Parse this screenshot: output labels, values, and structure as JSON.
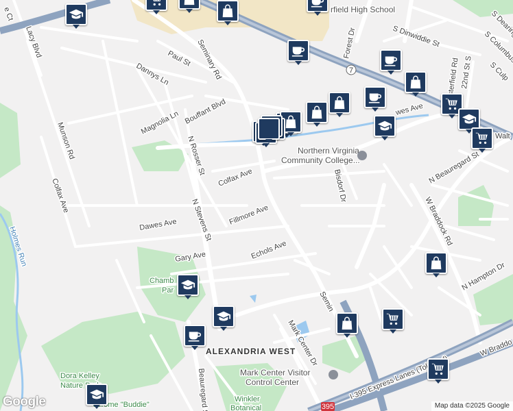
{
  "labels": {
    "lacy": "Lacy Blvd",
    "paul": "Paul St",
    "seminary_rd": "Seminary Rd",
    "dannys": "Dannys Ln",
    "magnolia": "Magnolia Ln",
    "bouffant": "Bouffant Blvd",
    "munson": "Munson Rd",
    "n_rosser": "N Rosser St",
    "colfax_ave_east": "Colfax Ave",
    "colfax_ave_west": "Colfax Ave",
    "holmes_run": "Holmes Run",
    "dawes_west": "Dawes Ave",
    "n_stevens": "N Stevens St",
    "fillmore": "Fillmore Ave",
    "gary": "Gary Ave",
    "echols": "Echols Ave",
    "chamb": "Chamb",
    "park": "Par",
    "alexandria_west": "ALEXANDRIA WEST",
    "dora_kelley_1": "Dora Kelley",
    "dora_kelley_2": "Nature Park",
    "jerome": "Jerome \"Buddie\"",
    "winkler_1": "Winkler",
    "winkler_2": "Botanical",
    "mark_center_dr": "Mark Center Dr",
    "mark_center_vc_1": "Mark Center Visitor",
    "mark_center_vc_2": "Control Center",
    "nvcc_1": "Northern Virginia",
    "nvcc_2": "Community College...",
    "bisdorf": "Bisdorf Dr",
    "forest": "Forest Dr",
    "s_dinwiddie": "S Dinwiddie St",
    "field_high": "rfield High School",
    "dawes_east": "wes Ave",
    "n_beauregard": "N Beauregard St",
    "w_braddock_rd": "W Braddock Rd",
    "n_hampton": "N Hampton Dr",
    "seminary_south": "Semin",
    "i395_express": "I-395 Express Lanes (Toll road)",
    "w_braddo": "W Braddo",
    "beauregard_st": "Beauregard St",
    "s_chesterfield": "sterfield Rd",
    "s_22nd": "22nd St S",
    "s_columbus": "S Columbus St",
    "s_dearing": "S Dearing St",
    "s_culpeper": "S Culp",
    "walt": "Walt",
    "route7": "7",
    "route395": "395",
    "ct": "e Ct"
  },
  "markers": [
    {
      "type": "school",
      "icon": "school-icon"
    },
    {
      "type": "shopping",
      "icon": "cart-icon"
    },
    {
      "type": "store",
      "icon": "bag-icon"
    },
    {
      "type": "store",
      "icon": "bag-icon"
    },
    {
      "type": "cafe",
      "icon": "coffee-icon"
    },
    {
      "type": "cafe",
      "icon": "coffee-icon"
    },
    {
      "type": "cafe",
      "icon": "coffee-icon"
    },
    {
      "type": "store",
      "icon": "bag-icon"
    },
    {
      "type": "cafe",
      "icon": "coffee-icon"
    },
    {
      "type": "store",
      "icon": "bag-icon"
    },
    {
      "type": "store",
      "icon": "bag-icon"
    },
    {
      "type": "shopping",
      "icon": "cart-icon"
    },
    {
      "type": "school",
      "icon": "school-icon"
    },
    {
      "type": "school",
      "icon": "school-icon"
    },
    {
      "type": "shopping",
      "icon": "cart-icon"
    },
    {
      "type": "restaurant",
      "icon": "fork-knife-icon"
    },
    {
      "type": "shopping",
      "icon": "cart-icon"
    },
    {
      "type": "store",
      "icon": "bag-icon"
    },
    {
      "type": "school",
      "icon": "school-icon"
    },
    {
      "type": "store",
      "icon": "bag-icon"
    },
    {
      "type": "school",
      "icon": "school-icon"
    },
    {
      "type": "cafe",
      "icon": "coffee-icon"
    },
    {
      "type": "store",
      "icon": "bag-icon"
    },
    {
      "type": "shopping",
      "icon": "cart-icon"
    },
    {
      "type": "shopping",
      "icon": "cart-icon"
    },
    {
      "type": "school",
      "icon": "school-icon"
    }
  ],
  "attribution": "Map data ©2025 Google",
  "logo": "Google",
  "colors": {
    "background": "#f2f1f1",
    "park": "#c5e8c6",
    "water": "#9cc9ef",
    "highway": "#8ea3bf",
    "road": "#ffffff",
    "campus": "#f2e6c6",
    "marker": "#1f3a5f"
  }
}
